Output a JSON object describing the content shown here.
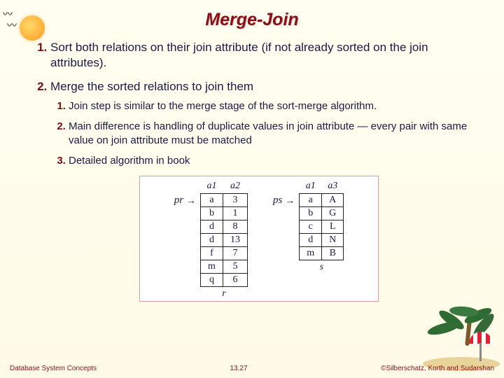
{
  "title": "Merge-Join",
  "bullets": {
    "b1": "Sort both relations on their join attribute (if not already sorted on the join attributes).",
    "b2": "Merge the sorted relations to join them",
    "sub": {
      "s1": "Join step is similar to the merge stage of the sort-merge algorithm.",
      "s2": "Main difference is handling of duplicate values in join attribute — every pair with same value on join attribute must be matched",
      "s3": "Detailed algorithm in book"
    }
  },
  "diagram": {
    "ptr_left": "pr",
    "ptr_right": "ps",
    "arrow": "→",
    "left": {
      "headers": [
        "a1",
        "a2"
      ],
      "rows": [
        [
          "a",
          "3"
        ],
        [
          "b",
          "1"
        ],
        [
          "d",
          "8"
        ],
        [
          "d",
          "13"
        ],
        [
          "f",
          "7"
        ],
        [
          "m",
          "5"
        ],
        [
          "q",
          "6"
        ]
      ],
      "label": "r"
    },
    "right": {
      "headers": [
        "a1",
        "a3"
      ],
      "rows": [
        [
          "a",
          "A"
        ],
        [
          "b",
          "G"
        ],
        [
          "c",
          "L"
        ],
        [
          "d",
          "N"
        ],
        [
          "m",
          "B"
        ]
      ],
      "label": "s"
    }
  },
  "footer": {
    "left": "Database System Concepts",
    "center": "13.27",
    "right": "©Silberschatz, Korth and Sudarshan"
  }
}
